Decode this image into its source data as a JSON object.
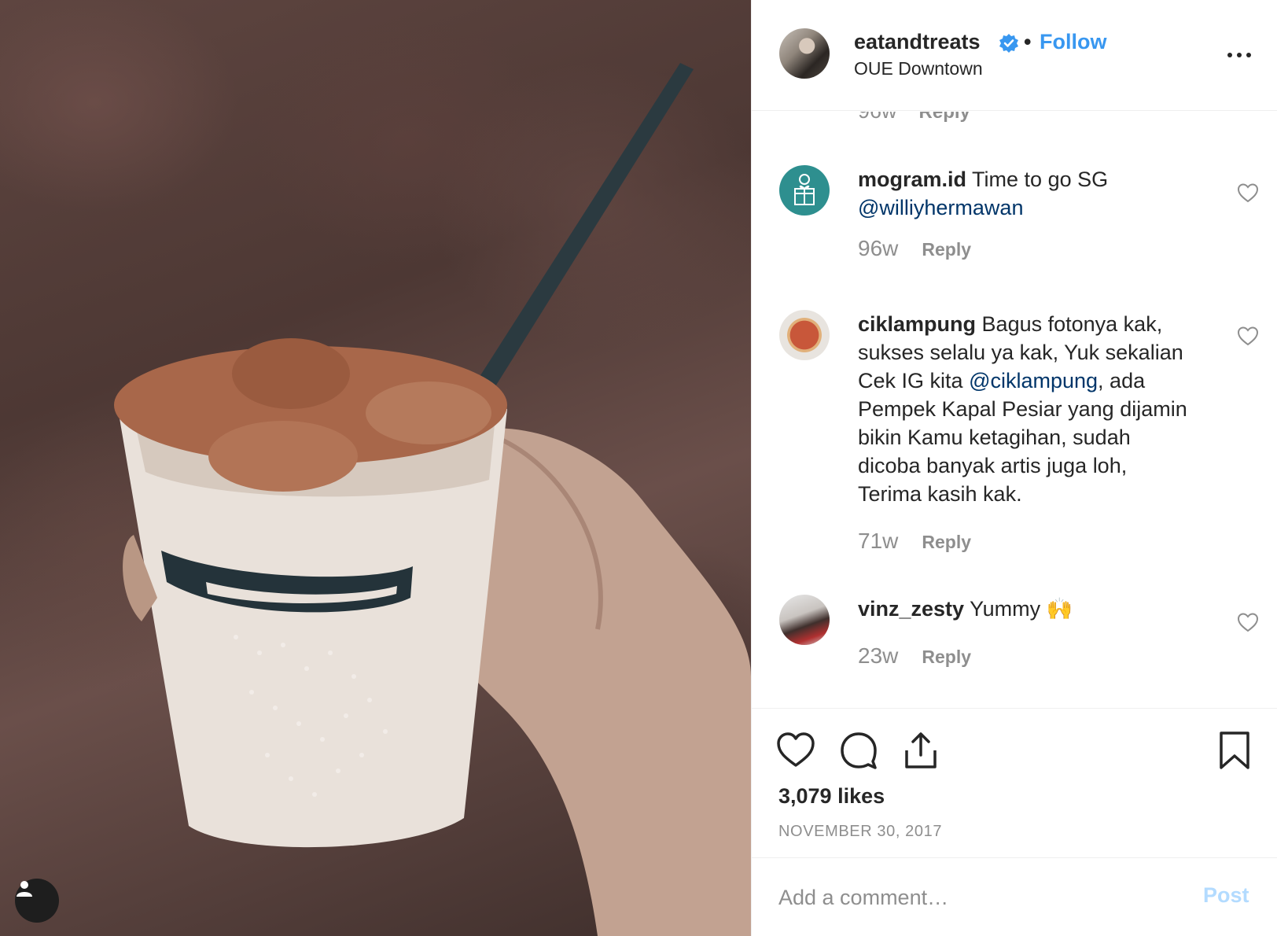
{
  "post": {
    "owner": "eatandtreats",
    "separator": "•",
    "follow_label": "Follow",
    "location": "OUE Downtown",
    "verified": true
  },
  "comments": {
    "previous_meta": {
      "age": "96w",
      "reply_label": "Reply"
    },
    "items": [
      {
        "user": "mogram.id",
        "text": "Time to go SG",
        "mention": "@williyhermawan",
        "age": "96w",
        "reply_label": "Reply"
      },
      {
        "user": "ciklampung",
        "text_before": "Bagus fotonya kak, sukses selalu ya kak, Yuk sekalian Cek IG kita",
        "mention": "@ciklampung",
        "text_after": ", ada Pempek Kapal Pesiar yang dijamin bikin Kamu ketagihan, sudah dicoba banyak artis juga loh, Terima kasih kak.",
        "age": "71w",
        "reply_label": "Reply"
      },
      {
        "user": "vinz_zesty",
        "text": "Yummy",
        "emoji": "🙌",
        "age": "23w",
        "reply_label": "Reply"
      }
    ]
  },
  "actions": {
    "likes": "3,079 likes",
    "date": "NOVEMBER 30, 2017"
  },
  "add_comment": {
    "placeholder": "Add a comment…",
    "post_label": "Post"
  },
  "colors": {
    "accent": "#3897f0",
    "mention": "#003569",
    "muted": "#8e8e8e",
    "post_disabled": "#b3dbff"
  }
}
